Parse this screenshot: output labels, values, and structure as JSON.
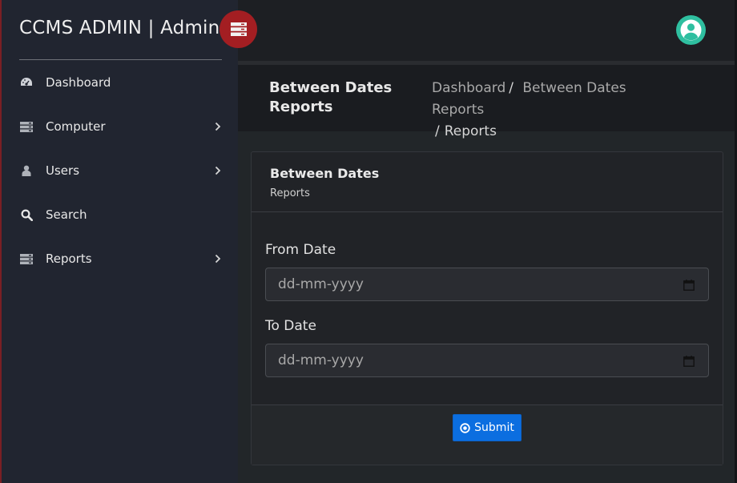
{
  "sidebar": {
    "brand": "CCMS ADMIN | Admin",
    "items": [
      {
        "label": "Dashboard",
        "icon": "dashboard-icon",
        "has_children": false
      },
      {
        "label": "Computer",
        "icon": "server-icon",
        "has_children": true
      },
      {
        "label": "Users",
        "icon": "user-icon",
        "has_children": true
      },
      {
        "label": "Search",
        "icon": "search-icon",
        "has_children": false
      },
      {
        "label": "Reports",
        "icon": "server-icon",
        "has_children": true
      }
    ]
  },
  "header": {
    "menu_icon": "menu-toggle-icon",
    "avatar_icon": "user-avatar-icon"
  },
  "page": {
    "title": "Between Dates Reports",
    "breadcrumb": [
      "Dashboard",
      "Between Dates Reports",
      "Reports"
    ]
  },
  "card": {
    "title": "Between Dates",
    "subtitle": "Reports",
    "from_label": "From Date",
    "from_placeholder": "dd-mm-yyyy",
    "to_label": "To Date",
    "to_placeholder": "dd-mm-yyyy",
    "submit_label": "Submit"
  },
  "colors": {
    "sidebar_bg": "#212530",
    "accent_red": "#a31e22",
    "avatar": "#2fbfa0",
    "primary_button": "#0b6ee0"
  }
}
